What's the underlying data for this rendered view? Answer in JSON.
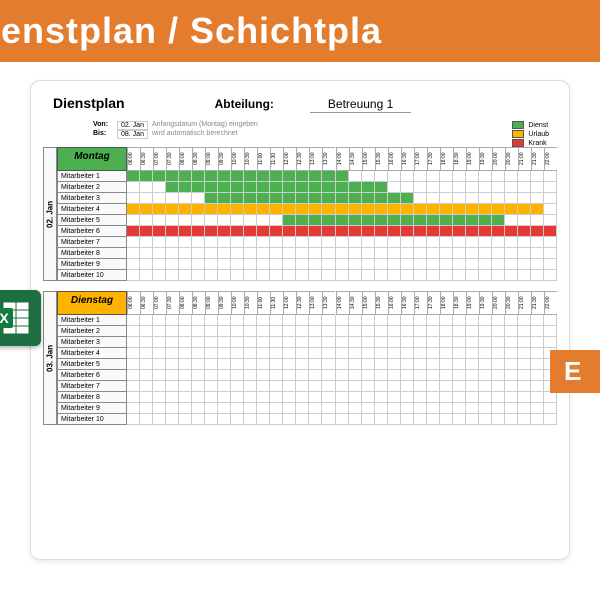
{
  "banner": "ienstplan / Schichtpla",
  "sheet": {
    "title": "Dienstplan",
    "dept_label": "Abteilung:",
    "dept_value": "Betreuung 1",
    "range": {
      "von_lbl": "Von:",
      "von_val": "02. Jan",
      "bis_lbl": "Bis:",
      "bis_val": "08. Jan",
      "note1": "Anfangsdatum (Montag) eingeben",
      "note2": "wird automatisch berechnet"
    },
    "legend": [
      {
        "color": "green",
        "label": "Dienst"
      },
      {
        "color": "orange",
        "label": "Urlaub"
      },
      {
        "color": "red",
        "label": "Krank"
      }
    ],
    "times": [
      "06:00",
      "06:30",
      "07:00",
      "07:30",
      "08:00",
      "08:30",
      "09:00",
      "09:30",
      "10:00",
      "10:30",
      "11:00",
      "11:30",
      "12:00",
      "12:30",
      "13:00",
      "13:30",
      "14:00",
      "14:30",
      "15:00",
      "15:30",
      "16:00",
      "16:30",
      "17:00",
      "17:30",
      "18:00",
      "18:30",
      "19:00",
      "19:30",
      "20:00",
      "20:30",
      "21:00",
      "21:30",
      "22:00"
    ],
    "employees": [
      "Mitarbeiter 1",
      "Mitarbeiter 2",
      "Mitarbeiter 3",
      "Mitarbeiter 4",
      "Mitarbeiter 5",
      "Mitarbeiter 6",
      "Mitarbeiter 7",
      "Mitarbeiter 8",
      "Mitarbeiter 9",
      "Mitarbeiter 10"
    ],
    "days": [
      {
        "date": "02. Jan",
        "name": "Montag",
        "hdr_class": "montag-hdr",
        "rows": [
          "ggggggggggggggggg----------------",
          "---ggggggggggggggggg-------------",
          "------gggggggggggggggg-----------",
          "oooooooooooooooooooooooooooooooo-",
          "------------ggggggggggggggggg----",
          "rrrrrrrrrrrrrrrrrrrrrrrrrrrrrrrrr",
          "---------------------------------",
          "---------------------------------",
          "---------------------------------",
          "---------------------------------"
        ]
      },
      {
        "date": "03. Jan",
        "name": "Dienstag",
        "hdr_class": "dienstag-hdr",
        "rows": [
          "---------------------------------",
          "---------------------------------",
          "---------------------------------",
          "---------------------------------",
          "---------------------------------",
          "---------------------------------",
          "---------------------------------",
          "---------------------------------",
          "---------------------------------",
          "---------------------------------"
        ]
      }
    ]
  },
  "excel_tab": "E"
}
